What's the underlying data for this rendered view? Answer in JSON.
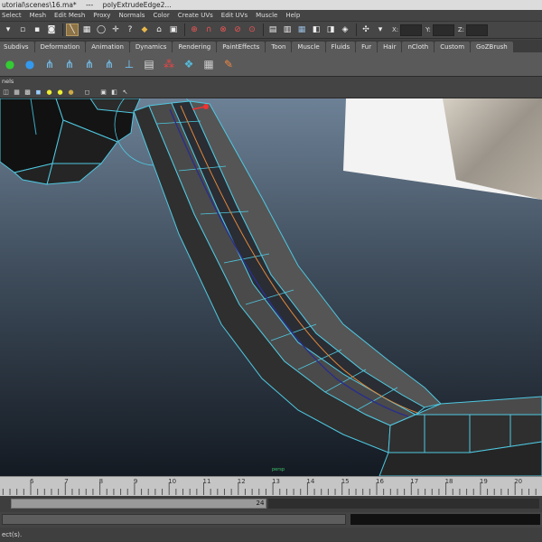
{
  "titlebar": {
    "path": "utorial\\scenes\\16.ma*",
    "sep": "---",
    "object": "polyExtrudeEdge2..."
  },
  "menubar": [
    "Select",
    "Mesh",
    "Edit Mesh",
    "Proxy",
    "Normals",
    "Color",
    "Create UVs",
    "Edit UVs",
    "Muscle",
    "Help"
  ],
  "statusline": {
    "x_label": "X:",
    "y_label": "Y:",
    "z_label": "Z:"
  },
  "shelf_tabs": [
    "Subdivs",
    "Deformation",
    "Animation",
    "Dynamics",
    "Rendering",
    "PaintEffects",
    "Toon",
    "Muscle",
    "Fluids",
    "Fur",
    "Hair",
    "nCloth",
    "Custom",
    "GoZBrush"
  ],
  "panel": {
    "menu_fragment": "nels"
  },
  "viewport": {
    "camera_label": "persp",
    "background_top": "#6d8196",
    "background_bottom": "#141a22",
    "wire_color": "#4fc8e0"
  },
  "timeline": {
    "ticks": [
      "6",
      "7",
      "8",
      "9",
      "10",
      "11",
      "12",
      "13",
      "14",
      "15",
      "16",
      "17",
      "18",
      "19",
      "20"
    ],
    "range_value": "24"
  },
  "helpline": {
    "text": "ect(s)."
  }
}
